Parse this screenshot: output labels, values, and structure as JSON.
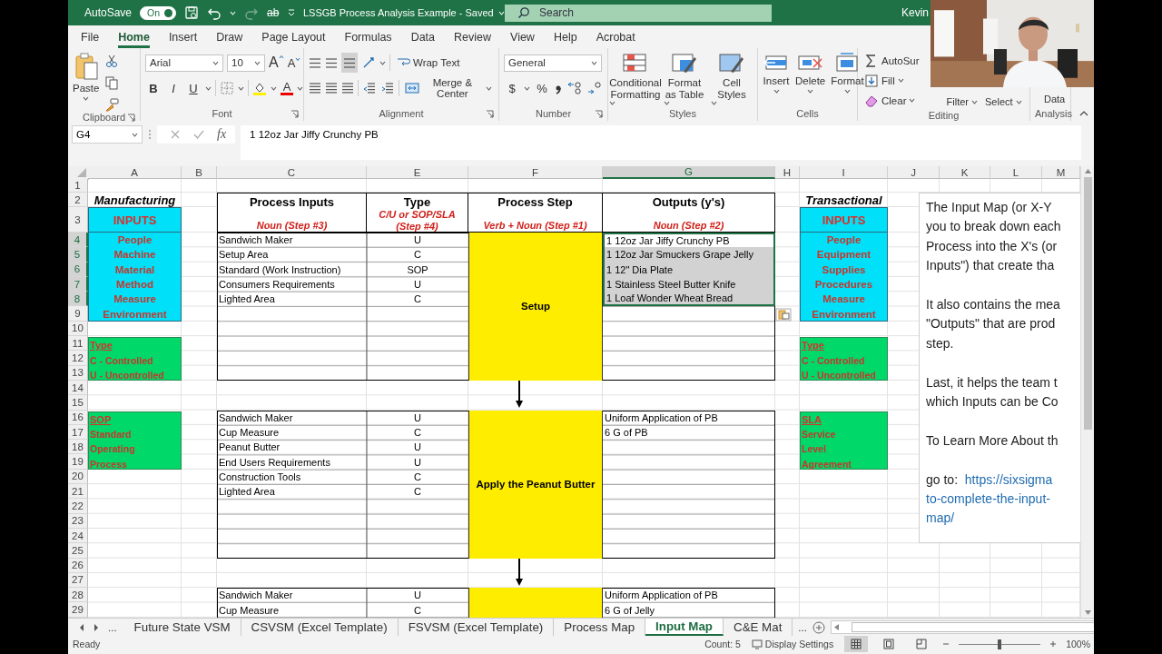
{
  "title_bar": {
    "autosave_label": "AutoSave",
    "autosave_toggle": {
      "label": "On",
      "on": true
    },
    "strikethrough": "ab",
    "document_title": "LSSGB Process Analysis Example  -  Saved",
    "search": {
      "placeholder": "Search"
    },
    "user": "Kevin"
  },
  "ribbon_tabs": [
    {
      "label": "File",
      "selected": false
    },
    {
      "label": "Home",
      "selected": true
    },
    {
      "label": "Insert",
      "selected": false
    },
    {
      "label": "Draw",
      "selected": false
    },
    {
      "label": "Page Layout",
      "selected": false
    },
    {
      "label": "Formulas",
      "selected": false
    },
    {
      "label": "Data",
      "selected": false
    },
    {
      "label": "Review",
      "selected": false
    },
    {
      "label": "View",
      "selected": false
    },
    {
      "label": "Help",
      "selected": false
    },
    {
      "label": "Acrobat",
      "selected": false
    }
  ],
  "ribbon": {
    "clipboard": {
      "paste": "Paste",
      "label": "Clipboard"
    },
    "font": {
      "font_name": "Arial",
      "font_size": "10",
      "grow": "A",
      "shrink": "A",
      "styles": [
        "B",
        "I",
        "U"
      ],
      "font_color_label": "A",
      "label": "Font"
    },
    "alignment": {
      "wrap_text": "Wrap Text",
      "merge": "Merge & Center",
      "label": "Alignment"
    },
    "number": {
      "format": "General",
      "currency": "$",
      "percent": "%",
      "label": "Number"
    },
    "styles": {
      "buttons": [
        "Conditional Formatting",
        "Format as Table",
        "Cell Styles"
      ],
      "label": "Styles"
    },
    "cells": {
      "buttons": [
        "Insert",
        "Delete",
        "Format"
      ],
      "label": "Cells"
    },
    "editing": {
      "buttons": [
        "AutoSur",
        "Fill",
        "Clear"
      ],
      "more": [
        "Filter",
        "Select"
      ],
      "label": "Editing"
    },
    "analysis": {
      "button": "Data",
      "label": "Analysis"
    }
  },
  "formula_bar": {
    "name_box": "G4",
    "function_label": "fx",
    "content": "1 12oz Jar Jiffy Crunchy PB"
  },
  "sheet": {
    "columns": [
      {
        "label": "A",
        "selected": false
      },
      {
        "label": "B",
        "selected": false
      },
      {
        "label": "C",
        "selected": false
      },
      {
        "label": "E",
        "selected": false
      },
      {
        "label": "F",
        "selected": false
      },
      {
        "label": "G",
        "selected": true
      },
      {
        "label": "H",
        "selected": false
      },
      {
        "label": "I",
        "selected": false
      },
      {
        "label": "J",
        "selected": false
      },
      {
        "label": "K",
        "selected": false
      },
      {
        "label": "L",
        "selected": false
      },
      {
        "label": "M",
        "selected": false
      }
    ],
    "rows": [
      {
        "label": "1",
        "selected": false
      },
      {
        "label": "2",
        "selected": false
      },
      {
        "label": "3",
        "selected": false
      },
      {
        "label": "4",
        "selected": true
      },
      {
        "label": "5",
        "selected": true
      },
      {
        "label": "6",
        "selected": true
      },
      {
        "label": "7",
        "selected": true
      },
      {
        "label": "8",
        "selected": true
      },
      {
        "label": "9",
        "selected": false
      },
      {
        "label": "10",
        "selected": false
      },
      {
        "label": "11",
        "selected": false
      },
      {
        "label": "12",
        "selected": false
      },
      {
        "label": "13",
        "selected": false
      },
      {
        "label": "14",
        "selected": false
      },
      {
        "label": "15",
        "selected": false
      },
      {
        "label": "16",
        "selected": false
      },
      {
        "label": "17",
        "selected": false
      },
      {
        "label": "18",
        "selected": false
      },
      {
        "label": "19",
        "selected": false
      },
      {
        "label": "20",
        "selected": false
      },
      {
        "label": "21",
        "selected": false
      },
      {
        "label": "22",
        "selected": false
      },
      {
        "label": "23",
        "selected": false
      },
      {
        "label": "24",
        "selected": false
      },
      {
        "label": "25",
        "selected": false
      },
      {
        "label": "26",
        "selected": false
      },
      {
        "label": "27",
        "selected": false
      },
      {
        "label": "28",
        "selected": false
      },
      {
        "label": "29",
        "selected": false
      }
    ]
  },
  "left_panel": {
    "title": "Manufacturing",
    "inputs": {
      "heading": "INPUTS",
      "items": [
        "People",
        "Machine",
        "Material",
        "Method",
        "Measure",
        "Environment"
      ]
    },
    "legends": [
      {
        "title": "Type",
        "items": [
          "C - Controlled",
          "U - Uncontrolled"
        ]
      },
      {
        "title": "SOP",
        "items": [
          "Standard",
          "Operating",
          "Process"
        ]
      }
    ]
  },
  "right_panel": {
    "title": "Transactional",
    "inputs": {
      "heading": "INPUTS",
      "items": [
        "People",
        "Equipment",
        "Supplies",
        "Procedures",
        "Measure",
        "Environment"
      ]
    },
    "legends": [
      {
        "title": "Type",
        "items": [
          "C - Controlled",
          "U - Uncontrolled"
        ]
      },
      {
        "title": "SLA",
        "items": [
          "Service",
          "Level",
          "Agreement"
        ]
      }
    ]
  },
  "process_table": {
    "columns": [
      {
        "title": "Process Inputs",
        "hint": "Noun (Step #3)"
      },
      {
        "title": "Type",
        "hint": "C/U or SOP/SLA (Step #4)"
      },
      {
        "title": "Process Step",
        "hint": "Verb + Noun (Step #1)"
      },
      {
        "title": "Outputs (y's)",
        "hint": "Noun (Step #2)"
      }
    ],
    "blocks": [
      {
        "step": "Setup",
        "rows": [
          {
            "input": "Sandwich Maker",
            "type": "U",
            "output": "1 12oz Jar Jiffy Crunchy PB",
            "selected": true
          },
          {
            "input": "Setup Area",
            "type": "C",
            "output": "1 12oz Jar Smuckers Grape Jelly",
            "selected": true
          },
          {
            "input": "Standard (Work Instruction)",
            "type": "SOP",
            "output": "1 12\" Dia Plate",
            "selected": true
          },
          {
            "input": "Consumers Requirements",
            "type": "U",
            "output": "1 Stainless Steel Butter Knife",
            "selected": true
          },
          {
            "input": "Lighted Area",
            "type": "C",
            "output": "1 Loaf Wonder Wheat Bread",
            "selected": true
          },
          {},
          {},
          {},
          {},
          {}
        ]
      },
      {
        "step": "Apply the Peanut Butter",
        "rows": [
          {
            "input": "Sandwich Maker",
            "type": "U",
            "output": "Uniform Application of PB",
            "selected": false
          },
          {
            "input": "Cup Measure",
            "type": "C",
            "output": "6 G of PB",
            "selected": false
          },
          {
            "input": "Peanut Butter",
            "type": "U",
            "selected": false
          },
          {
            "input": "End Users Requirements",
            "type": "U",
            "selected": false
          },
          {
            "input": "Construction Tools",
            "type": "C",
            "selected": false
          },
          {
            "input": "Lighted Area",
            "type": "C",
            "selected": false
          },
          {},
          {},
          {},
          {}
        ]
      },
      {
        "rows": [
          {
            "input": "Sandwich Maker",
            "type": "U",
            "output": "Uniform Application of PB",
            "selected": false
          },
          {
            "input": "Cup Measure",
            "type": "C",
            "output": "6 G of Jelly",
            "selected": false
          }
        ]
      }
    ]
  },
  "text_box": {
    "paragraphs": [
      [
        "The Input Map (or X-Y",
        "you to break down each",
        "Process into the X's (or",
        "Inputs\") that create tha"
      ],
      [
        "It also contains the mea",
        "\"Outputs\" that are prod",
        "step."
      ],
      [
        "Last, it helps the team t",
        "which Inputs can be Co"
      ],
      [
        "To Learn More About th"
      ]
    ],
    "link": {
      "prefix": "go to:",
      "lines": [
        "https://sixsigma",
        "to-complete-the-input-",
        "map/"
      ]
    }
  },
  "sheet_tabs": {
    "overflow_left": "...",
    "tabs": [
      {
        "label": "Future State VSM",
        "selected": false
      },
      {
        "label": "CSVSM (Excel Template)",
        "selected": false
      },
      {
        "label": "FSVSM (Excel Template)",
        "selected": false
      },
      {
        "label": "Process Map",
        "selected": false
      },
      {
        "label": "Input Map",
        "selected": true
      },
      {
        "label": "C&E Mat",
        "selected": false
      }
    ],
    "overflow_right": "..."
  },
  "status_bar": {
    "ready": "Ready",
    "count": "Count: 5",
    "display_settings": "Display Settings",
    "zoom_slider": {
      "level": 0.5
    },
    "zoom": "100%"
  }
}
